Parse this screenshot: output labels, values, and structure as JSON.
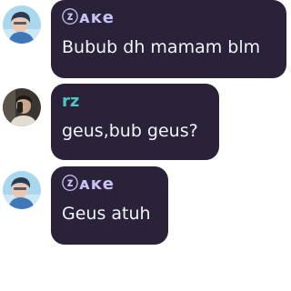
{
  "messages": [
    {
      "sender": "ⓩᴀᴋe",
      "text": "Bubub dh mamam blm",
      "avatar": "avatar-person-blue-icon",
      "sender_color": "#c6c2f5"
    },
    {
      "sender": "rz",
      "text": "geus,bub geus?",
      "avatar": "avatar-person-dark-icon",
      "sender_color": "#4fc6c3"
    },
    {
      "sender": "ⓩᴀᴋe",
      "text": "Geus atuh",
      "avatar": "avatar-person-blue-icon",
      "sender_color": "#c6c2f5"
    }
  ],
  "colors": {
    "bubble_bg": "#2a2238",
    "message_text": "#f4f2fa",
    "page_bg": "#ffffff"
  }
}
